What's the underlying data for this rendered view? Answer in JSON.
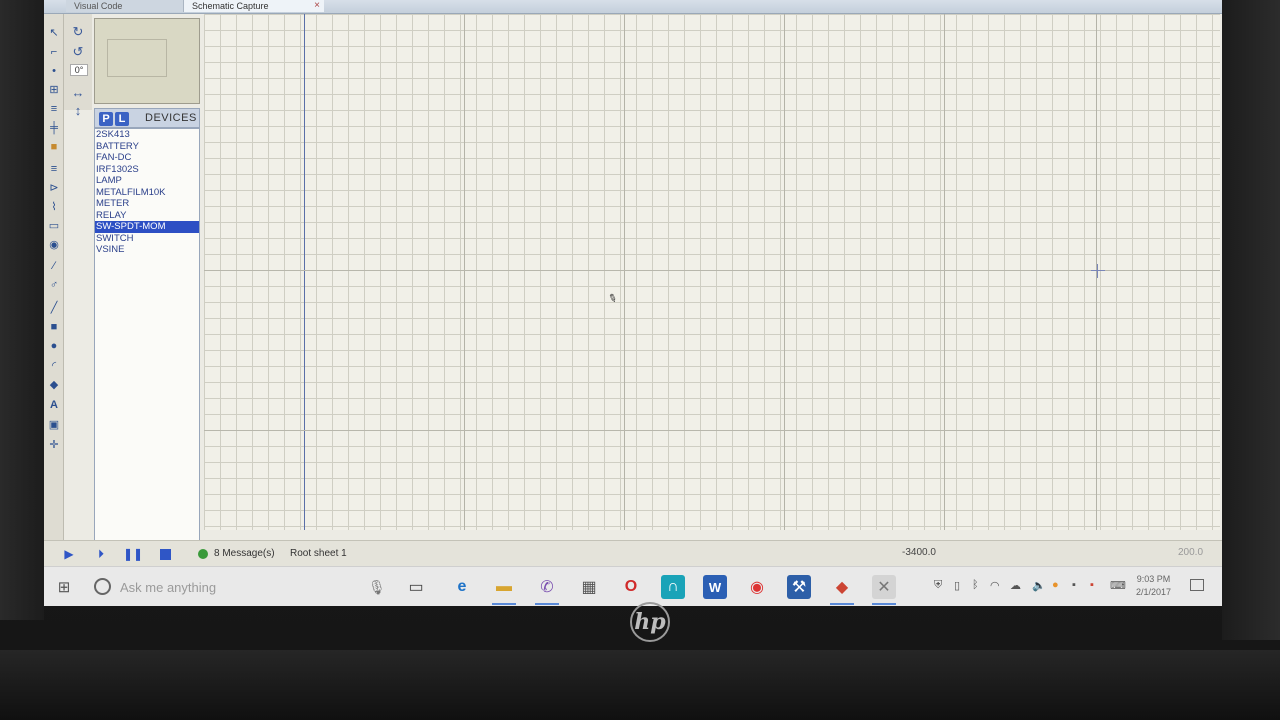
{
  "window": {
    "tabs": [
      {
        "label": "Visual Code",
        "active": false
      },
      {
        "label": "Schematic Capture",
        "active": true
      }
    ],
    "close_glyph": "×"
  },
  "rotation": {
    "angle_label": "0°"
  },
  "device_panel": {
    "p_label": "P",
    "l_label": "L",
    "title": "DEVICES",
    "items": [
      "2SK413",
      "BATTERY",
      "FAN-DC",
      "IRF1302S",
      "LAMP",
      "METALFILM10K",
      "METER",
      "RELAY",
      "SW-SPDT-MOM",
      "SWITCH",
      "VSINE"
    ],
    "selected": "SW-SPDT-MOM"
  },
  "status": {
    "messages": "8 Message(s)",
    "sheet": "Root sheet 1",
    "x_coord": "-3400.0",
    "y_coord": "200.0"
  },
  "taskbar": {
    "search_placeholder": "Ask me anything",
    "time": "9:03 PM",
    "date": "2/1/2017",
    "icons": [
      "windows-start-icon",
      "search-icon",
      "microphone-icon",
      "task-view-icon",
      "edge-icon",
      "file-explorer-icon",
      "viber-icon",
      "store-icon",
      "opera-icon",
      "headphones-icon",
      "word-icon",
      "chrome-icon",
      "tools-icon",
      "proteus-isis-icon",
      "proteus-ares-icon"
    ]
  },
  "brand": {
    "logo_text": "hp"
  },
  "colors": {
    "selection": "#2d4fc4",
    "accent": "#2f56c6",
    "grid": "#cfcec3"
  }
}
